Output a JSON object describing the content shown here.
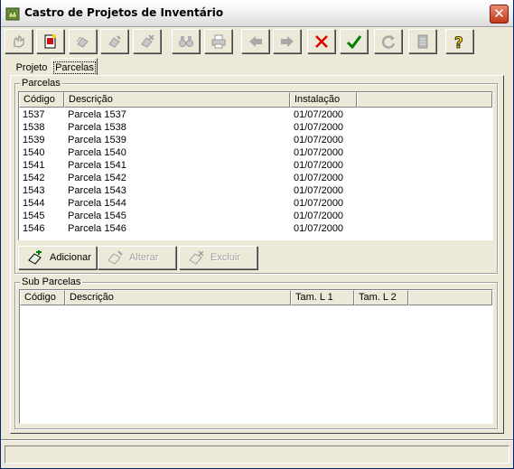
{
  "window": {
    "title": "Castro de Projetos de Inventário"
  },
  "toolbar": {
    "buttons": [
      {
        "icon": "hand-icon",
        "enabled": false
      },
      {
        "icon": "new-record-icon",
        "enabled": true
      },
      {
        "icon": "copy-icon",
        "enabled": false
      },
      {
        "icon": "edit-icon",
        "enabled": false
      },
      {
        "icon": "delete-icon",
        "enabled": false
      },
      {
        "icon": "binoculars-icon",
        "enabled": false
      },
      {
        "icon": "print-icon",
        "enabled": false
      },
      {
        "icon": "arrow-left-icon",
        "enabled": false
      },
      {
        "icon": "arrow-right-icon",
        "enabled": false
      },
      {
        "icon": "cancel-x-icon",
        "enabled": true,
        "color": "#e00000"
      },
      {
        "icon": "confirm-check-icon",
        "enabled": true,
        "color": "#008000"
      },
      {
        "icon": "refresh-icon",
        "enabled": false
      },
      {
        "icon": "document-icon",
        "enabled": false
      },
      {
        "icon": "help-icon",
        "enabled": true,
        "color": "#ffd200"
      }
    ]
  },
  "tabs": [
    {
      "label": "Projeto",
      "active": false
    },
    {
      "label": "Parcelas",
      "active": true
    }
  ],
  "parcelas": {
    "group_label": "Parcelas",
    "columns": [
      "Código",
      "Descrição",
      "Instalação"
    ],
    "rows": [
      [
        "1537",
        "Parcela 1537",
        "01/07/2000"
      ],
      [
        "1538",
        "Parcela 1538",
        "01/07/2000"
      ],
      [
        "1539",
        "Parcela 1539",
        "01/07/2000"
      ],
      [
        "1540",
        "Parcela 1540",
        "01/07/2000"
      ],
      [
        "1541",
        "Parcela 1541",
        "01/07/2000"
      ],
      [
        "1542",
        "Parcela 1542",
        "01/07/2000"
      ],
      [
        "1543",
        "Parcela 1543",
        "01/07/2000"
      ],
      [
        "1544",
        "Parcela 1544",
        "01/07/2000"
      ],
      [
        "1545",
        "Parcela 1545",
        "01/07/2000"
      ],
      [
        "1546",
        "Parcela 1546",
        "01/07/2000"
      ]
    ],
    "buttons": {
      "add": "Adicionar",
      "edit": "Alterar",
      "delete": "Excluir"
    }
  },
  "sub_parcelas": {
    "group_label": "Sub Parcelas",
    "columns": [
      "Código",
      "Descrição",
      "Tam. L 1",
      "Tam. L 2"
    ]
  }
}
